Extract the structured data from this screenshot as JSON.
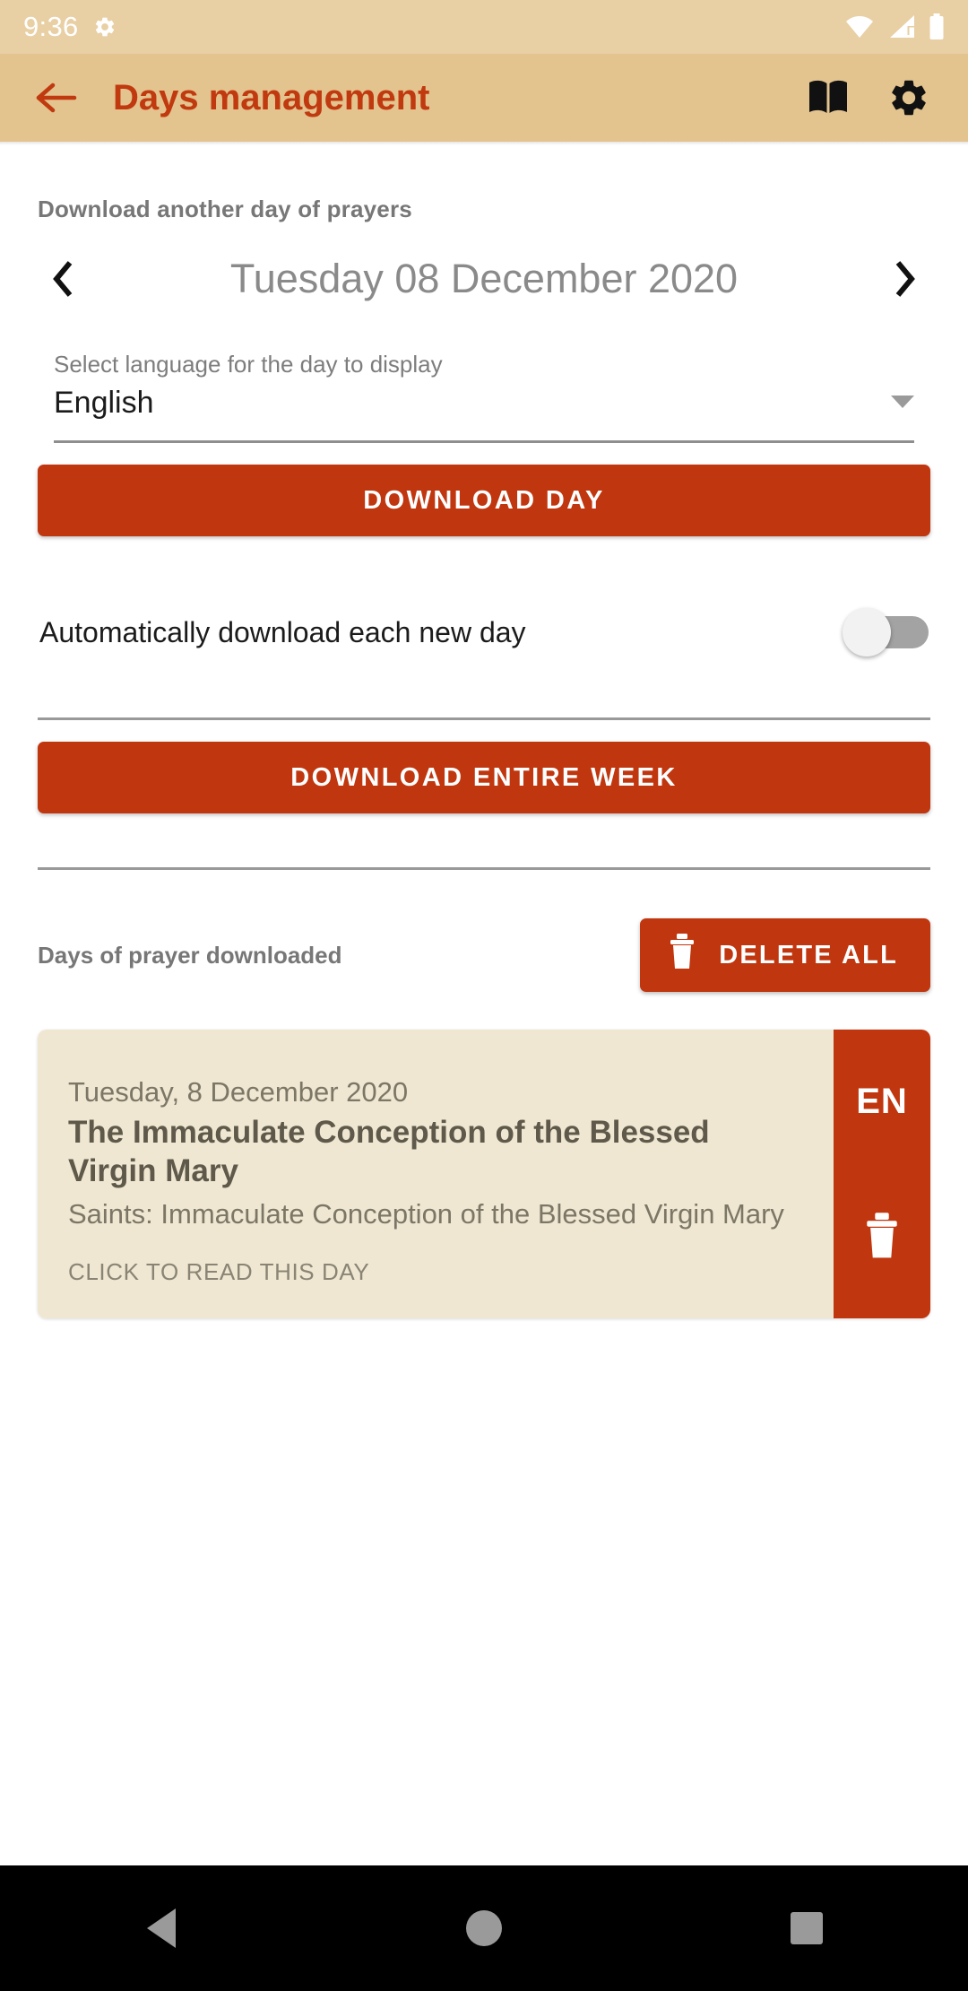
{
  "status_bar": {
    "time": "9:36",
    "icons": [
      "settings-gear-icon",
      "wifi-icon",
      "cell-signal-icon",
      "battery-icon"
    ]
  },
  "app_bar": {
    "back_icon": "back-arrow-icon",
    "title": "Days management",
    "actions": [
      {
        "icon": "book-icon"
      },
      {
        "icon": "gear-icon"
      }
    ]
  },
  "main": {
    "download_section_label": "Download another day of prayers",
    "date_selector": {
      "prev_icon": "chevron-left-icon",
      "value": "Tuesday 08 December 2020",
      "next_icon": "chevron-right-icon"
    },
    "language_select": {
      "label": "Select language for the day to display",
      "value": "English",
      "caret_icon": "caret-down-icon"
    },
    "download_day_button": "DOWNLOAD DAY",
    "auto_download": {
      "label": "Automatically download each new day",
      "state": "off"
    },
    "download_week_button": "DOWNLOAD ENTIRE WEEK",
    "downloaded_section": {
      "label": "Days of prayer downloaded",
      "delete_all_button": "DELETE ALL",
      "delete_all_icon": "trash-icon"
    },
    "day_cards": [
      {
        "date": "Tuesday, 8 December 2020",
        "title": "The Immaculate Conception of the Blessed Virgin Mary",
        "saints": "Saints: Immaculate Conception of the Blessed Virgin Mary",
        "cta": "CLICK TO READ THIS DAY",
        "language_code": "EN",
        "delete_icon": "trash-icon"
      }
    ]
  },
  "nav_bar": {
    "back": "nav-back-icon",
    "home": "nav-home-icon",
    "recents": "nav-recents-icon"
  },
  "colors": {
    "status_bar_bg": "#E8CFA4",
    "app_bar_bg": "#E3C38E",
    "accent": "#C0360F",
    "card_bg": "#EFE7D1",
    "page_bg": "#FFFFFF"
  }
}
